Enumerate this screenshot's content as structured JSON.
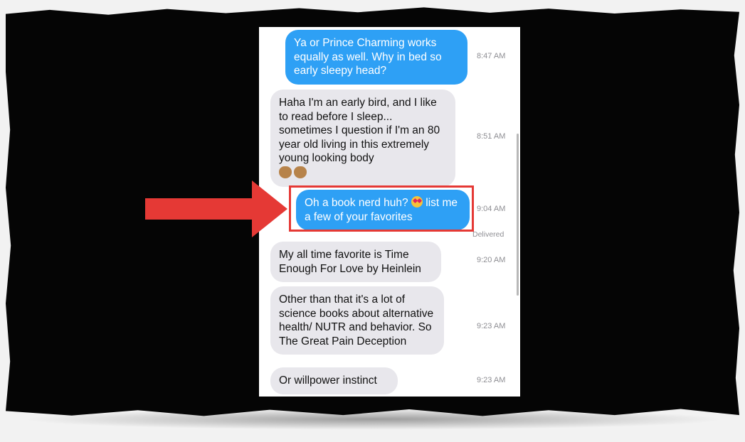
{
  "messages": [
    {
      "direction": "sent",
      "text": "Ya or Prince Charming works equally as well.  Why in bed so early sleepy head?",
      "time": "8:47 AM"
    },
    {
      "direction": "received",
      "text": "Haha I'm an early bird, and I like to read before I sleep... sometimes I question if I'm an 80 year old living in this extremely young looking body",
      "emoji": [
        "see-no-evil-monkey",
        "see-no-evil-monkey"
      ],
      "time": "8:51 AM"
    },
    {
      "direction": "sent",
      "text_before": "Oh a book nerd huh?",
      "text_after": "list me a few of your favorites",
      "emoji": "heart-eyes",
      "time": "9:04 AM",
      "status": "Delivered",
      "highlighted": true
    },
    {
      "direction": "received",
      "text": "My all time favorite is Time Enough For Love by Heinlein",
      "time": "9:20 AM"
    },
    {
      "direction": "received",
      "text": "Other than that it's a lot of science books about alternative health/ NUTR and behavior. So The Great Pain Deception",
      "time": "9:23 AM"
    },
    {
      "direction": "received",
      "text": "Or willpower instinct",
      "time": "9:23 AM"
    }
  ],
  "annotation": {
    "arrow_color": "#e53935",
    "box_color": "#e53935"
  },
  "colors": {
    "sent_bubble": "#2ea0f5",
    "received_bubble": "#e8e7ec",
    "frame": "#050505"
  }
}
